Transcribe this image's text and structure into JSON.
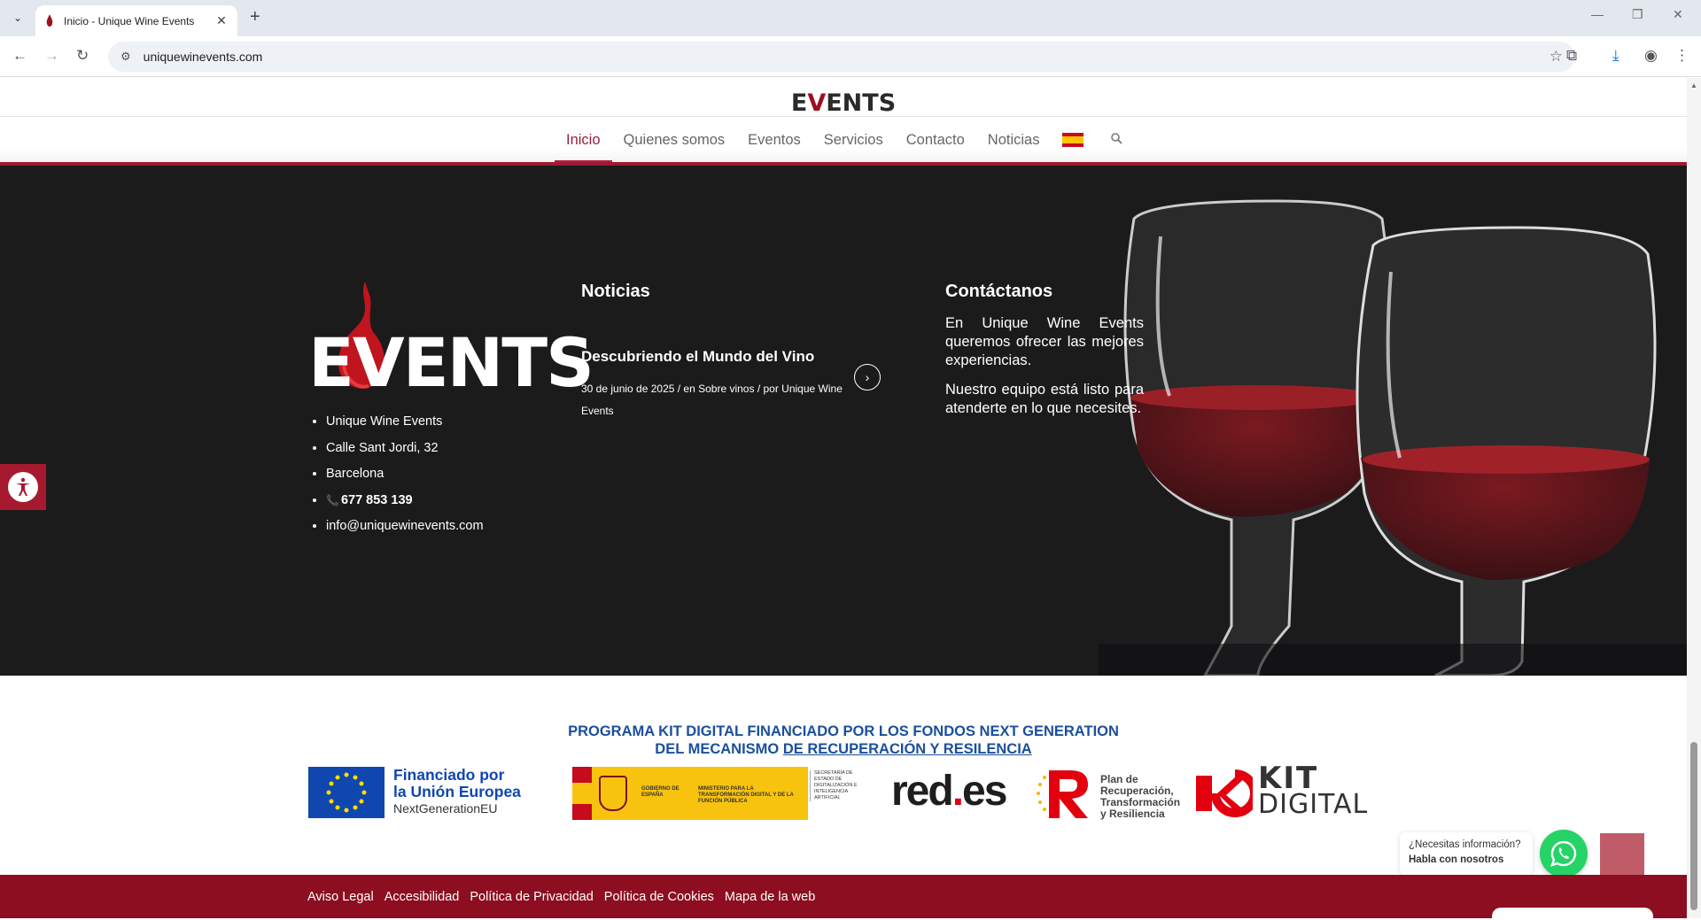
{
  "browser": {
    "tab_title": "Inicio - Unique Wine Events",
    "url": "uniquewinevents.com"
  },
  "header": {
    "logo_text_1": "E",
    "logo_text_v": "V",
    "logo_text_2": "ENTS",
    "menu": [
      {
        "label": "Inicio",
        "active": true
      },
      {
        "label": "Quienes somos"
      },
      {
        "label": "Eventos"
      },
      {
        "label": "Servicios"
      },
      {
        "label": "Contacto"
      },
      {
        "label": "Noticias"
      }
    ],
    "language": "es"
  },
  "footer_logo": "EVENTS",
  "contact": {
    "items": [
      "Unique Wine Events",
      "Calle Sant Jordi, 32",
      "Barcelona",
      "677 853 139",
      "info@uniquewinevents.com"
    ]
  },
  "news": {
    "title": "Noticias",
    "post_title": "Descubriendo el Mundo del Vino",
    "post_meta": "30 de junio de 2025  /  en Sobre vinos  /  por Unique Wine Events"
  },
  "contactanos": {
    "title": "Contáctanos",
    "p1": "En Unique Wine Events queremos ofrecer las mejores experiencias.",
    "p2": "Nuestro equipo está listo para atenderte en lo que necesites."
  },
  "kit_digital": {
    "heading_line1": "PROGRAMA KIT DIGITAL FINANCIADO POR LOS FONDOS NEXT GENERATION",
    "heading_line2a": "DEL MECANISMO ",
    "heading_line2b": "DE RECUPERACIÓN Y RESILENCIA",
    "eu_line1": "Financiado por",
    "eu_line2": "la Unión Europea",
    "eu_line3": "NextGenerationEU",
    "gob_1": "GOBIERNO DE ESPAÑA",
    "gob_2": "MINISTERIO PARA LA TRANSFORMACIÓN DIGITAL Y DE LA FUNCIÓN PÚBLICA",
    "secretaria": "SECRETARÍA DE ESTADO DE DIGITALIZACIÓN E INTELIGENCIA ARTIFICIAL",
    "redes_a": "red",
    "redes_b": ".",
    "redes_c": "es",
    "plan_line1": "Plan de",
    "plan_line2": "Recuperación,",
    "plan_line3": "Transformación",
    "plan_line4": "y Resiliencia",
    "kit_line1": "KIT",
    "kit_line2": "DIGITAL"
  },
  "whatsapp": {
    "line1": "¿Necesitas información?",
    "line2": "Habla con nosotros"
  },
  "footer_links": [
    "Aviso Legal",
    "Accesibilidad",
    "Política de Privacidad",
    "Política de Cookies",
    "Mapa de la web"
  ],
  "colors": {
    "brand_red": "#9c1020",
    "footer_bar": "#8c0e20",
    "dark_bg": "#1b1b1c",
    "kit_blue": "#1b4f9c"
  }
}
